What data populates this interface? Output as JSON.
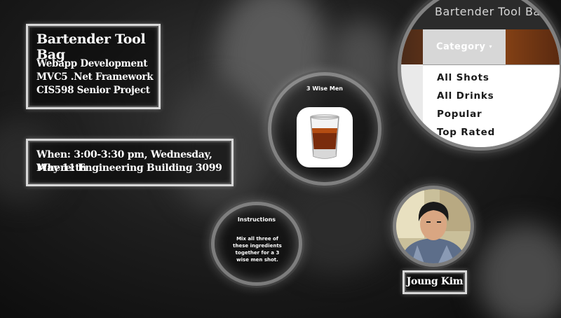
{
  "intro": {
    "title": "Bartender Tool Bag",
    "lines": [
      "Webapp Development",
      "MVC5 .Net Framework",
      "CIS598 Senior Project"
    ]
  },
  "schedule": {
    "when": "When: 3:00-3:30 pm, Wednesday, May 11th",
    "where": "Where: Engineering Building 3099"
  },
  "drink_card": {
    "name": "3 Wise Men",
    "image_icon": "shot-glass-icon"
  },
  "instructions": {
    "title": "Instructions",
    "text": "Mix all three of these ingredients together for a 3 wise men shot."
  },
  "presenter": {
    "name": "Joung Kim",
    "photo_icon": "avatar-photo"
  },
  "app_preview": {
    "brand": "Bartender Tool Bag",
    "category_label": "Category",
    "menu_items": [
      "All Shots",
      "All Drinks",
      "Popular",
      "Top Rated"
    ]
  }
}
